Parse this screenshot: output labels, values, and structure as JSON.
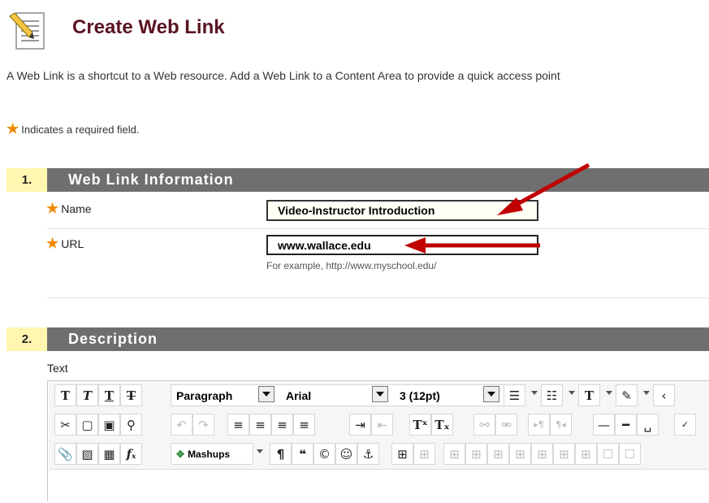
{
  "header": {
    "title": "Create Web Link"
  },
  "intro": "A Web Link is a shortcut to a Web resource. Add a Web Link to a Content Area to provide a quick access point",
  "required_note": "Indicates a required field.",
  "section1": {
    "number": "1.",
    "title": "Web Link Information",
    "name_label": "Name",
    "name_value": "Video-Instructor Introduction",
    "url_label": "URL",
    "url_value": "www.wallace.edu",
    "url_hint": "For example, http://www.myschool.edu/"
  },
  "section2": {
    "number": "2.",
    "title": "Description",
    "text_label": "Text"
  },
  "toolbar": {
    "paragraph": "Paragraph",
    "font": "Arial",
    "size": "3 (12pt)",
    "mashups": "Mashups"
  },
  "colors": {
    "accent": "#f08a00",
    "title": "#5a1420",
    "section_bar": "#6f6f6f",
    "step_bg": "#fff6b0",
    "arrow": "#c00000"
  }
}
